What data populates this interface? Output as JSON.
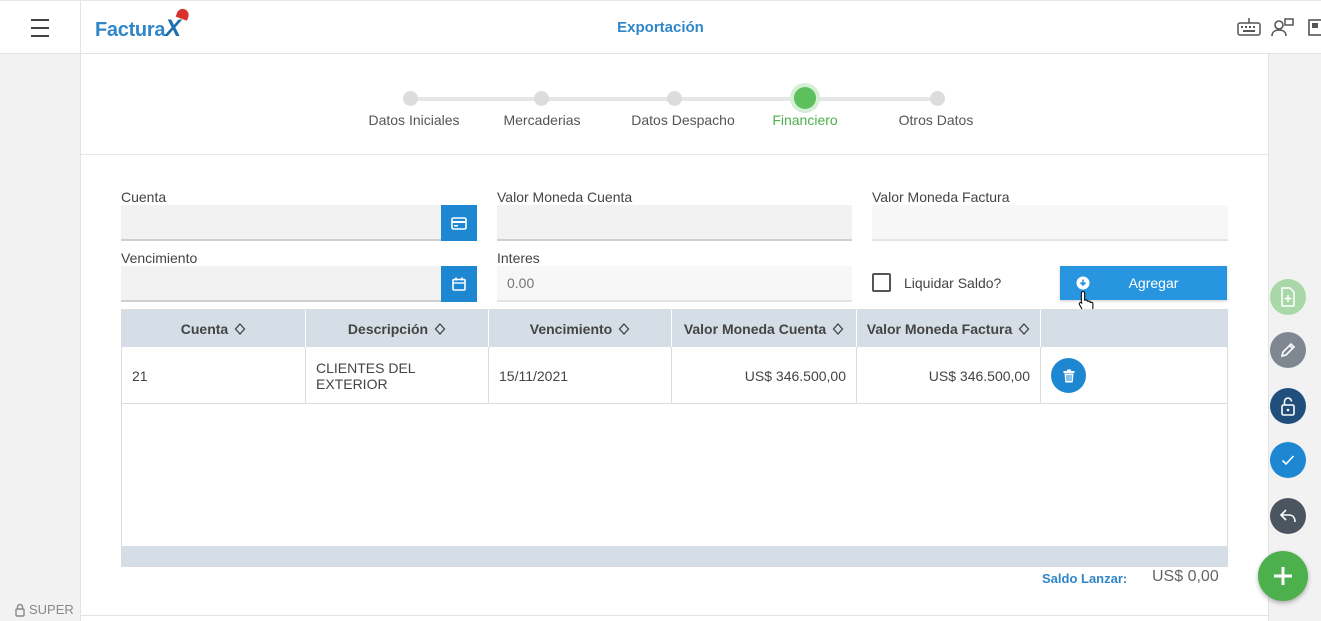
{
  "app": {
    "logo_text": "Factura",
    "logo_x": "X",
    "page_title": "Exportación"
  },
  "stepper": {
    "steps": [
      {
        "label": "Datos Iniciales"
      },
      {
        "label": "Mercaderias"
      },
      {
        "label": "Datos Despacho"
      },
      {
        "label": "Financiero"
      },
      {
        "label": "Otros Datos"
      }
    ],
    "active_index": 3
  },
  "form": {
    "cuenta_label": "Cuenta",
    "valor_moneda_cuenta_label": "Valor Moneda Cuenta",
    "valor_moneda_factura_label": "Valor Moneda Factura",
    "vencimiento_label": "Vencimiento",
    "interes_label": "Interes",
    "interes_placeholder": "0.00",
    "liquidar_saldo_label": "Liquidar Saldo?",
    "agregar_label": "Agregar"
  },
  "table": {
    "headers": [
      "Cuenta",
      "Descripción",
      "Vencimiento",
      "Valor Moneda Cuenta",
      "Valor Moneda Factura"
    ],
    "rows": [
      {
        "cuenta": "21",
        "descripcion": "CLIENTES DEL EXTERIOR",
        "vencimiento": "15/11/2021",
        "valor_cuenta": "US$ 346.500,00",
        "valor_factura": "US$ 346.500,00"
      }
    ]
  },
  "saldo": {
    "label": "Saldo Lanzar:",
    "value": "US$ 0,00"
  },
  "user": {
    "name": "SUPER"
  },
  "colors": {
    "accent": "#2f86c9",
    "button": "#1e87d2",
    "active_step": "#5cc15c",
    "fab_green": "#4cb04c"
  }
}
